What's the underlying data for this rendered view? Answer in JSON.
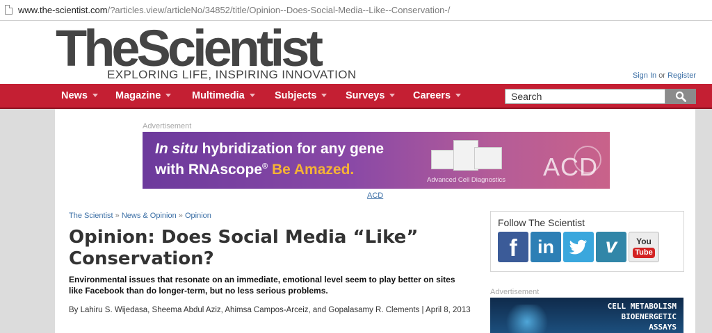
{
  "browser": {
    "url_domain": "www.the-scientist.com",
    "url_path": "/?articles.view/articleNo/34852/title/Opinion--Does-Social-Media--Like--Conservation-/"
  },
  "header": {
    "logo": "TheScientist",
    "tagline": "EXPLORING LIFE, INSPIRING INNOVATION",
    "sign_in": "Sign In",
    "or": "or",
    "register": "Register"
  },
  "nav": {
    "items": [
      {
        "label": "News"
      },
      {
        "label": "Magazine"
      },
      {
        "label": "Multimedia"
      },
      {
        "label": "Subjects"
      },
      {
        "label": "Surveys"
      },
      {
        "label": "Careers"
      }
    ],
    "search_placeholder": "Search"
  },
  "ad_top": {
    "label": "Advertisement",
    "line1_italic": "In situ",
    "line1_rest": " hybridization for any gene",
    "line2_prefix": "with RNAscope",
    "line2_reg": "®",
    "line2_highlight": "Be Amazed.",
    "company": "Advanced Cell Diagnostics",
    "brand": "ACD",
    "sponsor": "ACD"
  },
  "article": {
    "breadcrumb": [
      "The Scientist",
      "News & Opinion",
      "Opinion"
    ],
    "breadcrumb_sep": "»",
    "title": "Opinion: Does Social Media “Like” Conservation?",
    "deck": "Environmental issues that resonate on an immediate, emotional level seem to play better on sites like Facebook than do longer-term, but no less serious problems.",
    "byline": "By Lahiru S. Wijedasa, Sheema Abdul Aziz, Ahimsa Campos-Arceiz, and Gopalasamy R. Clements | April 8, 2013"
  },
  "sidebar": {
    "follow_title": "Follow The Scientist",
    "social": [
      {
        "name": "facebook",
        "glyph": "f"
      },
      {
        "name": "linkedin",
        "glyph": "in"
      },
      {
        "name": "twitter",
        "glyph": ""
      },
      {
        "name": "vimeo",
        "glyph": "v"
      },
      {
        "name": "youtube",
        "you": "You",
        "tube": "Tube"
      }
    ],
    "ad_label": "Advertisement",
    "ad_line1": "CELL METABOLISM",
    "ad_line2": "BIOENERGETIC",
    "ad_line3": "ASSAYS"
  },
  "colors": {
    "nav_red": "#c41f33",
    "link_blue": "#3a6ea5",
    "facebook": "#3b5b98",
    "linkedin": "#2d7fb5",
    "twitter": "#3aa7dd",
    "vimeo": "#3186a8",
    "youtube": "#d32323"
  }
}
